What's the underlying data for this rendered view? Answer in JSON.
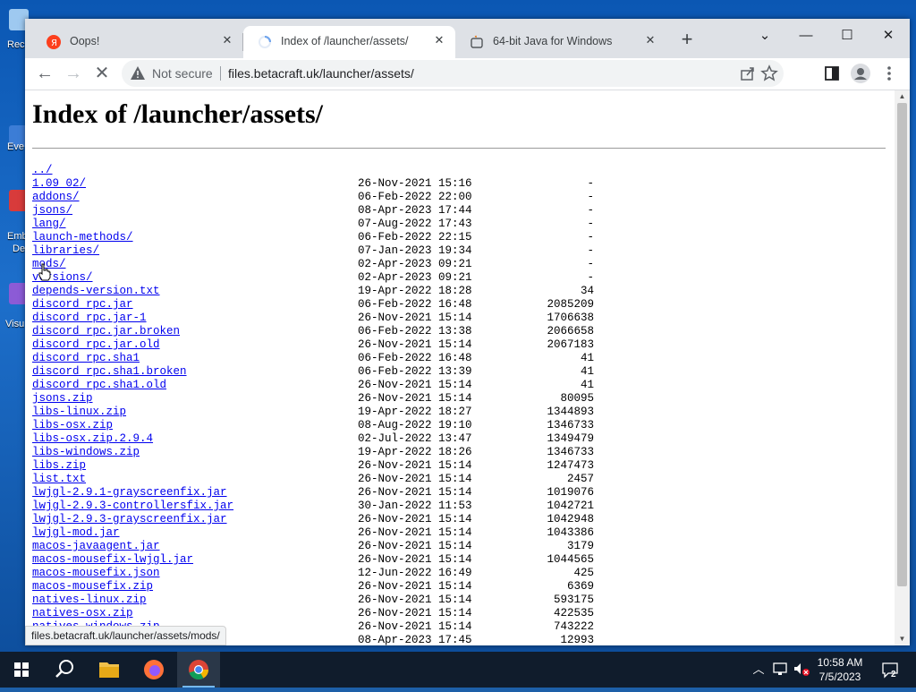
{
  "desktop": {
    "icons": [
      {
        "label": "Rec",
        "color": "#9ec9f0"
      },
      {
        "label": "Eve",
        "color": "#3c7dd6"
      },
      {
        "label": "Emb",
        "color": "#d83b3b",
        "label2": "De"
      },
      {
        "label": "Visu",
        "color": "#8c5bd6"
      }
    ]
  },
  "browser": {
    "tabs": [
      {
        "title": "Oops!",
        "icon": "yandex-icon"
      },
      {
        "title": "Index of /launcher/assets/",
        "icon": "loading-spinner-icon"
      },
      {
        "title": "64-bit Java for Windows",
        "icon": "java-icon"
      }
    ],
    "new_tab": "+",
    "security_label": "Not secure",
    "url": "files.betacraft.uk/launcher/assets/",
    "status_url": "files.betacraft.uk/launcher/assets/mods/"
  },
  "page": {
    "heading": "Index of /launcher/assets/",
    "parent_link": "../",
    "entries": [
      {
        "name": "1.09_02/",
        "date": "26-Nov-2021 15:16",
        "size": "-"
      },
      {
        "name": "addons/",
        "date": "06-Feb-2022 22:00",
        "size": "-"
      },
      {
        "name": "jsons/",
        "date": "08-Apr-2023 17:44",
        "size": "-"
      },
      {
        "name": "lang/",
        "date": "07-Aug-2022 17:43",
        "size": "-"
      },
      {
        "name": "launch-methods/",
        "date": "06-Feb-2022 22:15",
        "size": "-"
      },
      {
        "name": "libraries/",
        "date": "07-Jan-2023 19:34",
        "size": "-"
      },
      {
        "name": "mods/",
        "date": "02-Apr-2023 09:21",
        "size": "-"
      },
      {
        "name": "versions/",
        "date": "02-Apr-2023 09:21",
        "size": "-"
      },
      {
        "name": "depends-version.txt",
        "date": "19-Apr-2022 18:28",
        "size": "34"
      },
      {
        "name": "discord_rpc.jar",
        "date": "06-Feb-2022 16:48",
        "size": "2085209"
      },
      {
        "name": "discord_rpc.jar-1",
        "date": "26-Nov-2021 15:14",
        "size": "1706638"
      },
      {
        "name": "discord_rpc.jar.broken",
        "date": "06-Feb-2022 13:38",
        "size": "2066658"
      },
      {
        "name": "discord_rpc.jar.old",
        "date": "26-Nov-2021 15:14",
        "size": "2067183"
      },
      {
        "name": "discord_rpc.sha1",
        "date": "06-Feb-2022 16:48",
        "size": "41"
      },
      {
        "name": "discord_rpc.sha1.broken",
        "date": "06-Feb-2022 13:39",
        "size": "41"
      },
      {
        "name": "discord_rpc.sha1.old",
        "date": "26-Nov-2021 15:14",
        "size": "41"
      },
      {
        "name": "jsons.zip",
        "date": "26-Nov-2021 15:14",
        "size": "80095"
      },
      {
        "name": "libs-linux.zip",
        "date": "19-Apr-2022 18:27",
        "size": "1344893"
      },
      {
        "name": "libs-osx.zip",
        "date": "08-Aug-2022 19:10",
        "size": "1346733"
      },
      {
        "name": "libs-osx.zip.2.9.4",
        "date": "02-Jul-2022 13:47",
        "size": "1349479"
      },
      {
        "name": "libs-windows.zip",
        "date": "19-Apr-2022 18:26",
        "size": "1346733"
      },
      {
        "name": "libs.zip",
        "date": "26-Nov-2021 15:14",
        "size": "1247473"
      },
      {
        "name": "list.txt",
        "date": "26-Nov-2021 15:14",
        "size": "2457"
      },
      {
        "name": "lwjgl-2.9.1-grayscreenfix.jar",
        "date": "26-Nov-2021 15:14",
        "size": "1019076"
      },
      {
        "name": "lwjgl-2.9.3-controllersfix.jar",
        "date": "30-Jan-2022 11:53",
        "size": "1042721"
      },
      {
        "name": "lwjgl-2.9.3-grayscreenfix.jar",
        "date": "26-Nov-2021 15:14",
        "size": "1042948"
      },
      {
        "name": "lwjgl-mod.jar",
        "date": "26-Nov-2021 15:14",
        "size": "1043386"
      },
      {
        "name": "macos-javaagent.jar",
        "date": "26-Nov-2021 15:14",
        "size": "3179"
      },
      {
        "name": "macos-mousefix-lwjgl.jar",
        "date": "26-Nov-2021 15:14",
        "size": "1044565"
      },
      {
        "name": "macos-mousefix.json",
        "date": "12-Jun-2022 16:49",
        "size": "425"
      },
      {
        "name": "macos-mousefix.zip",
        "date": "26-Nov-2021 15:14",
        "size": "6369"
      },
      {
        "name": "natives-linux.zip",
        "date": "26-Nov-2021 15:14",
        "size": "593175"
      },
      {
        "name": "natives-osx.zip",
        "date": "26-Nov-2021 15:14",
        "size": "422535"
      },
      {
        "name": "natives-windows.zip",
        "date": "26-Nov-2021 15:14",
        "size": "743222"
      },
      {
        "name": "",
        "date": "08-Apr-2023 17:45",
        "size": "12993"
      }
    ]
  },
  "taskbar": {
    "apps": [
      "start-icon",
      "search-icon",
      "file-explorer-icon",
      "firefox-icon",
      "chrome-icon"
    ],
    "active_app": "chrome-icon",
    "time": "10:58 AM",
    "date": "7/5/2023",
    "notification_count": "2"
  },
  "colors": {
    "link": "#0000ee",
    "tabstrip": "#dee1e6",
    "taskbar": "#101c2c"
  }
}
